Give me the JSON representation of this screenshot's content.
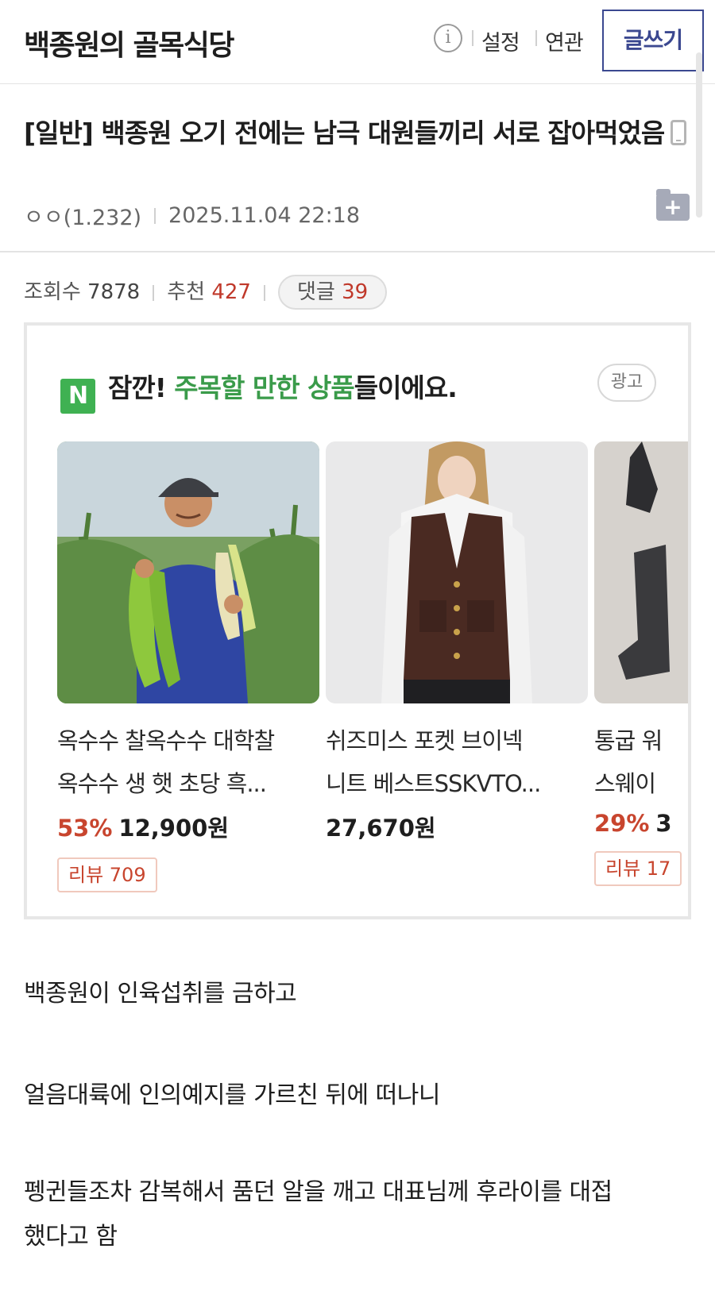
{
  "header": {
    "gallery_title": "백종원의 골목식당",
    "info_icon": "i",
    "settings_label": "설정",
    "related_label": "연관",
    "write_label": "글쓰기"
  },
  "post": {
    "title": "[일반] 백종원 오기 전에는 남극 대원들끼리 서로 잡아먹었음",
    "author": "ㅇㅇ(1.232)",
    "datetime": "2025.11.04 22:18",
    "folder_icon": "+"
  },
  "stats": {
    "views_label": "조회수",
    "views": "7878",
    "recommend_label": "추천",
    "recommend": "427",
    "comments_label": "댓글",
    "comments": "39"
  },
  "ad": {
    "logo": "N",
    "headline_prefix": "잠깐! ",
    "headline_highlight": "주목할 만한 상품",
    "headline_suffix": "들이에요.",
    "badge": "광고",
    "products": [
      {
        "name_line1": "옥수수 찰옥수수 대학찰",
        "name_line2": "옥수수 생 햇 초당 흑...",
        "discount": "53%",
        "price": "12,900원",
        "review": "리뷰 709"
      },
      {
        "name_line1": "쉬즈미스 포켓 브이넥",
        "name_line2": "니트 베스트SSKVTO...",
        "discount": "",
        "price": "27,670원",
        "review": ""
      },
      {
        "name_line1": "통굽 워",
        "name_line2": "스웨이",
        "discount": "29%",
        "price": "3",
        "review": "리뷰 17"
      }
    ]
  },
  "content": {
    "para1": "백종원이 인육섭취를 금하고",
    "para2": "얼음대륙에 인의예지를 가르친 뒤에 떠나니",
    "para3_line1": "펭귄들조차 감복해서 품던 알을 깨고 대표님께 후라이를 대접",
    "para3_line2": "했다고 함"
  }
}
